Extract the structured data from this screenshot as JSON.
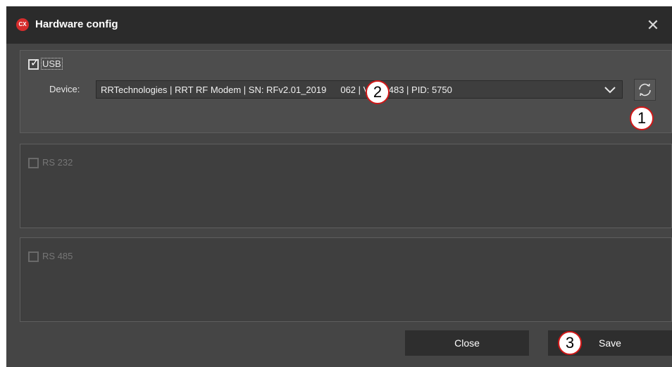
{
  "window": {
    "title": "Hardware config",
    "logo_text": "CX",
    "close_glyph": "✕"
  },
  "usb": {
    "label": "USB",
    "checked": true,
    "device_label": "Device:",
    "device_value": "RRTechnologies | RRT RF Modem | SN: RFv2.01_2019",
    "device_value_tail": "062 | VID: 0483 | PID: 5750"
  },
  "rs232": {
    "label": "RS 232",
    "checked": false
  },
  "rs485": {
    "label": "RS 485",
    "checked": false
  },
  "buttons": {
    "close": "Close",
    "save": "Save"
  },
  "callouts": {
    "one": "1",
    "two": "2",
    "three": "3"
  },
  "colors": {
    "callout_border": "#d01818",
    "logo": "#d62c2c"
  }
}
